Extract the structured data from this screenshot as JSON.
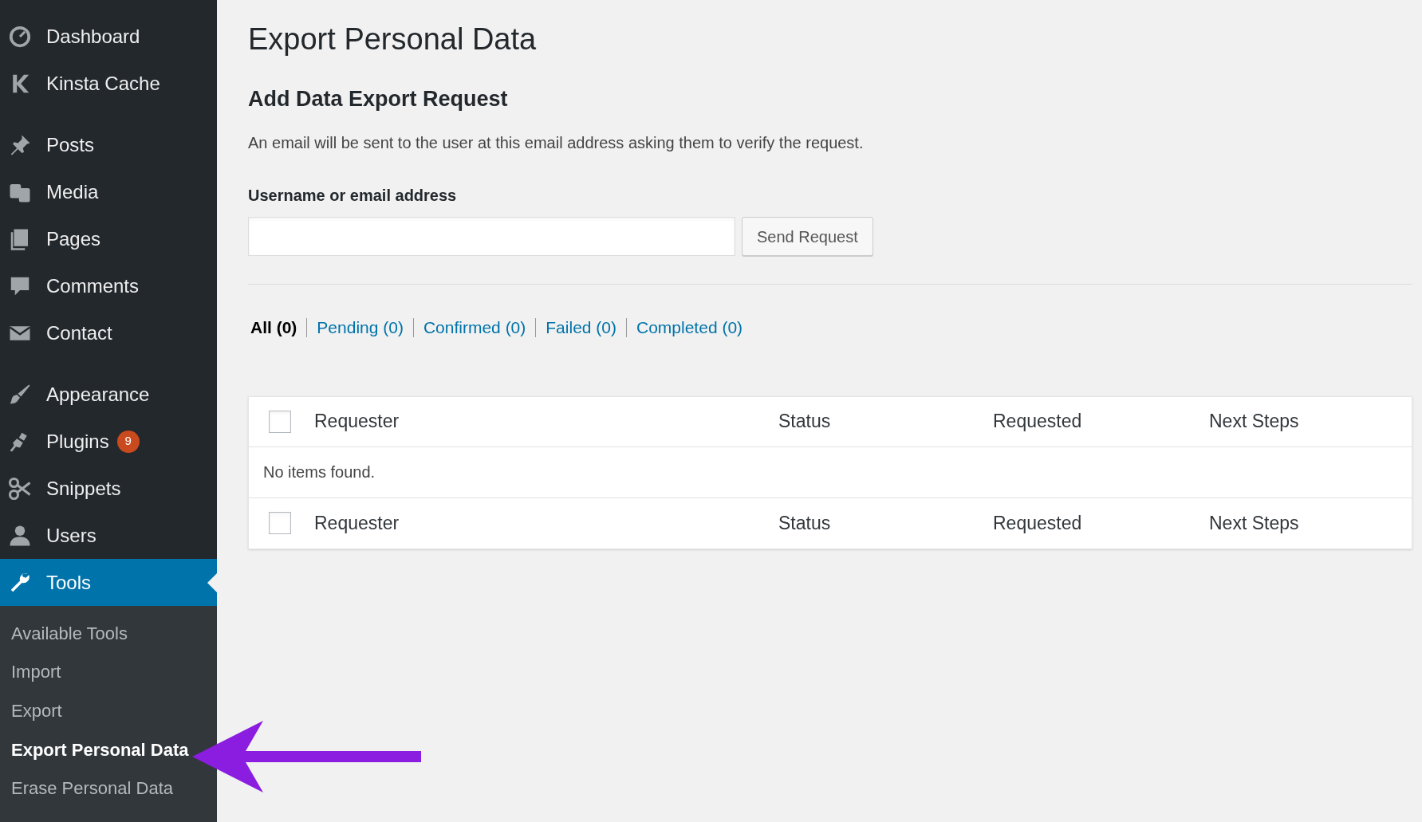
{
  "sidebar": {
    "menu_groups": [
      {
        "items": [
          {
            "label": "Dashboard",
            "selected": false
          },
          {
            "label": "Kinsta Cache",
            "selected": false
          }
        ]
      },
      {
        "items": [
          {
            "label": "Posts",
            "selected": false
          },
          {
            "label": "Media",
            "selected": false
          },
          {
            "label": "Pages",
            "selected": false
          },
          {
            "label": "Comments",
            "selected": false
          },
          {
            "label": "Contact",
            "selected": false
          }
        ]
      },
      {
        "items": [
          {
            "label": "Appearance",
            "selected": false
          },
          {
            "label": "Plugins",
            "selected": false,
            "badge": "9"
          },
          {
            "label": "Snippets",
            "selected": false
          },
          {
            "label": "Users",
            "selected": false
          },
          {
            "label": "Tools",
            "selected": true
          }
        ]
      }
    ],
    "submenu": [
      {
        "label": "Available Tools",
        "selected": false
      },
      {
        "label": "Import",
        "selected": false
      },
      {
        "label": "Export",
        "selected": false
      },
      {
        "label": "Export Personal Data",
        "selected": true
      },
      {
        "label": "Erase Personal Data",
        "selected": false
      }
    ]
  },
  "page": {
    "title": "Export Personal Data",
    "section_title": "Add Data Export Request",
    "description": "An email will be sent to the user at this email address asking them to verify the request.",
    "field_label": "Username or email address",
    "button": "Send Request",
    "filters": [
      {
        "label": "All (0)",
        "selected": true
      },
      {
        "label": "Pending (0)",
        "selected": false
      },
      {
        "label": "Confirmed (0)",
        "selected": false
      },
      {
        "label": "Failed (0)",
        "selected": false
      },
      {
        "label": "Completed (0)",
        "selected": false
      }
    ],
    "table": {
      "columns": [
        "Requester",
        "Status",
        "Requested",
        "Next Steps"
      ],
      "header_checked": false,
      "empty_message": "No items found.",
      "footer_columns": [
        "Requester",
        "Status",
        "Requested",
        "Next Steps"
      ],
      "footer_checked": false
    }
  }
}
